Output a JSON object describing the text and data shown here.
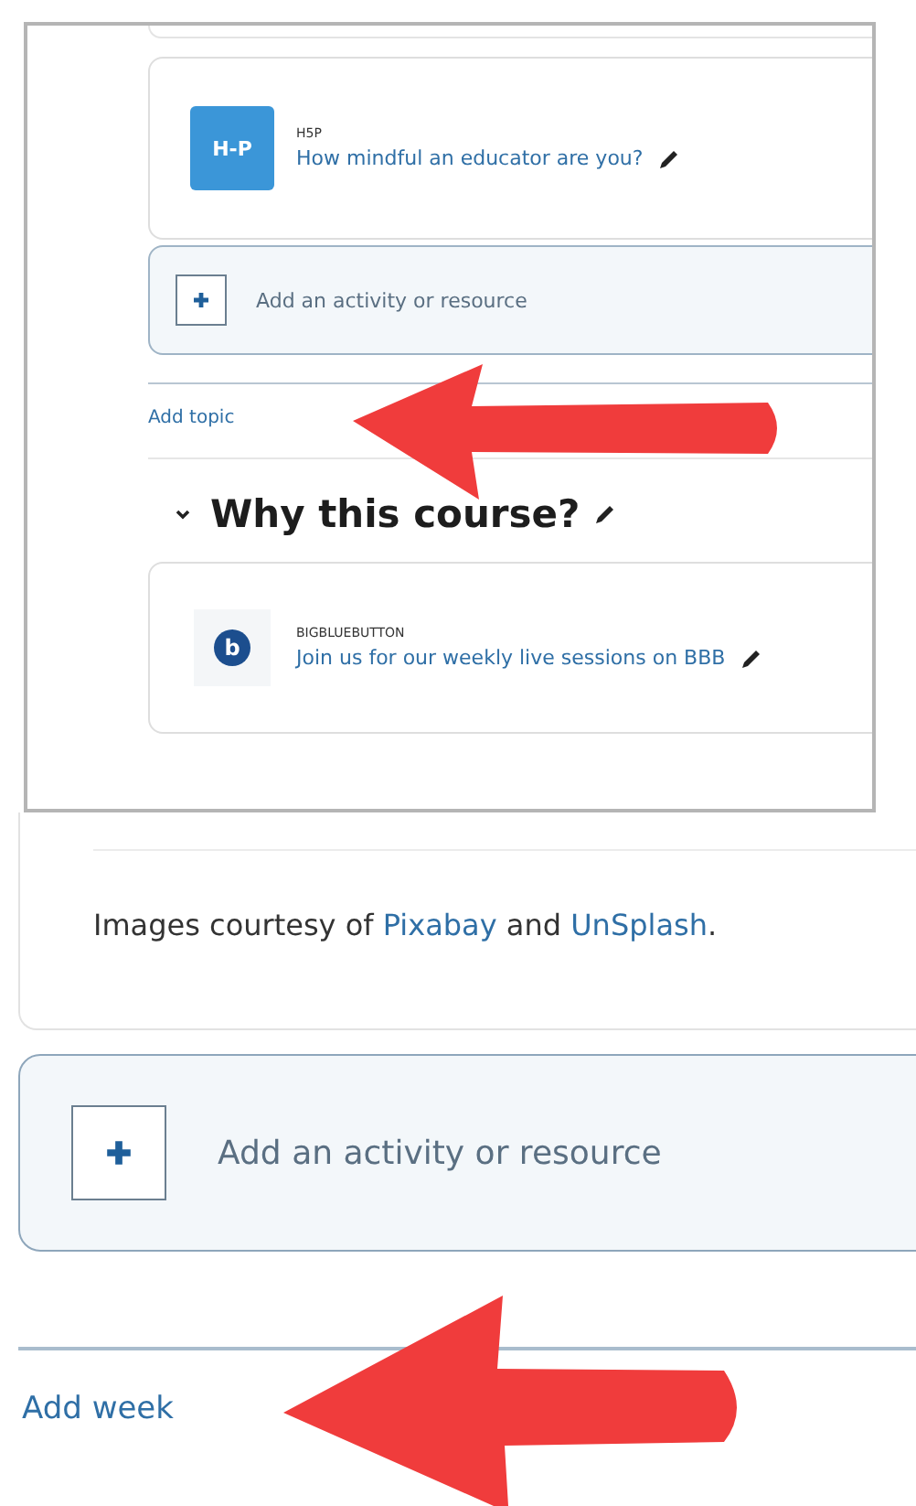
{
  "top_panel": {
    "activity": {
      "type": "H5P",
      "icon_text": "H-P",
      "title": "How mindful an educator are you?"
    },
    "add_activity": {
      "label": "Add an activity or resource"
    },
    "add_topic": "Add topic",
    "section": {
      "title": "Why this course?",
      "expanded": true,
      "activity": {
        "type": "BIGBLUEBUTTON",
        "icon_text": "b",
        "title": "Join us for our weekly live sessions on BBB"
      }
    }
  },
  "bottom_panel": {
    "credits": [
      {
        "kind": "text",
        "text": "Images courtesy of "
      },
      {
        "kind": "link",
        "text": "Pixabay"
      },
      {
        "kind": "text",
        "text": " and "
      },
      {
        "kind": "link",
        "text": "UnSplash"
      },
      {
        "kind": "text",
        "text": "."
      }
    ],
    "add_activity": {
      "label": "Add an activity or resource"
    },
    "add_week": "Add week"
  }
}
